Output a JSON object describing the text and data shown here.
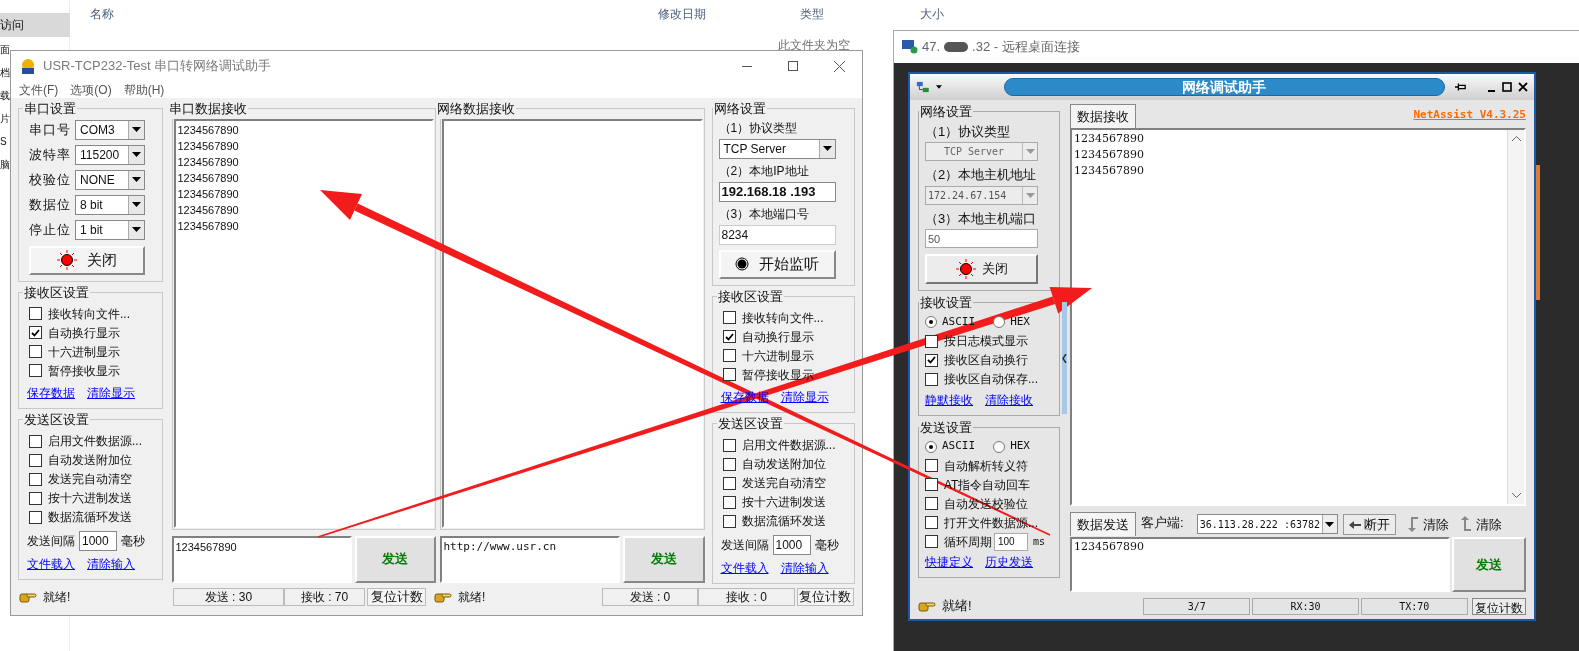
{
  "explorer": {
    "sidebar_items": [
      {
        "label": "访问",
        "selected": true
      },
      {
        "label": "面",
        "selected": false
      },
      {
        "label": "档",
        "selected": false
      },
      {
        "label": "载",
        "selected": false
      },
      {
        "label": "片",
        "selected": false
      },
      {
        "label": "S",
        "selected": false
      },
      {
        "label": "脑",
        "selected": false
      }
    ],
    "columns": [
      "名称",
      "修改日期",
      "类型",
      "大小"
    ],
    "empty_message": "此文件夹为空"
  },
  "usr_window": {
    "title": "USR-TCP232-Test 串口转网络调试助手",
    "menu": [
      "文件(F)",
      "选项(O)",
      "帮助(H)"
    ],
    "serial_settings": {
      "title": "串口设置",
      "fields": [
        {
          "label": "串口号",
          "value": "COM3"
        },
        {
          "label": "波特率",
          "value": "115200"
        },
        {
          "label": "校验位",
          "value": "NONE"
        },
        {
          "label": "数据位",
          "value": "8 bit"
        },
        {
          "label": "停止位",
          "value": "1 bit"
        }
      ],
      "button": "关闭"
    },
    "receive_settings": {
      "title": "接收区设置",
      "options": [
        {
          "label": "接收转向文件...",
          "checked": false
        },
        {
          "label": "自动换行显示",
          "checked": true
        },
        {
          "label": "十六进制显示",
          "checked": false
        },
        {
          "label": "暂停接收显示",
          "checked": false
        }
      ],
      "links": [
        "保存数据",
        "清除显示"
      ]
    },
    "send_settings": {
      "title": "发送区设置",
      "options": [
        {
          "label": "启用文件数据源...",
          "checked": false
        },
        {
          "label": "自动发送附加位",
          "checked": false
        },
        {
          "label": "发送完自动清空",
          "checked": false
        },
        {
          "label": "按十六进制发送",
          "checked": false
        },
        {
          "label": "数据流循环发送",
          "checked": false
        }
      ],
      "interval_label": "发送间隔",
      "interval": "1000",
      "interval_unit": "毫秒",
      "links": [
        "文件载入",
        "清除输入"
      ]
    },
    "serial_receive": {
      "title": "串口数据接收",
      "lines": [
        "1234567890",
        "1234567890",
        "1234567890",
        "1234567890",
        "1234567890",
        "1234567890",
        "1234567890"
      ]
    },
    "serial_send": {
      "value": "1234567890",
      "button": "发送"
    },
    "network_receive": {
      "title": "网络数据接收"
    },
    "network_send": {
      "value": "http://www.usr.cn",
      "button": "发送"
    },
    "network_settings": {
      "title": "网络设置",
      "protocol_label": "（1）协议类型",
      "protocol": "TCP Server",
      "ip_label": "（2）本地IP地址",
      "ip": "192.168.18 .193",
      "port_label": "（3）本地端口号",
      "port": "8234",
      "button": "开始监听"
    },
    "net_receive_settings": {
      "title": "接收区设置",
      "options": [
        {
          "label": "接收转向文件...",
          "checked": false
        },
        {
          "label": "自动换行显示",
          "checked": true
        },
        {
          "label": "十六进制显示",
          "checked": false
        },
        {
          "label": "暂停接收显示",
          "checked": false
        }
      ],
      "links": [
        "保存数据",
        "清除显示"
      ]
    },
    "net_send_settings": {
      "title": "发送区设置",
      "options": [
        {
          "label": "启用文件数据源...",
          "checked": false
        },
        {
          "label": "自动发送附加位",
          "checked": false
        },
        {
          "label": "发送完自动清空",
          "checked": false
        },
        {
          "label": "按十六进制发送",
          "checked": false
        },
        {
          "label": "数据流循环发送",
          "checked": false
        }
      ],
      "interval_label": "发送间隔",
      "interval": "1000",
      "interval_unit": "毫秒",
      "links": [
        "文件载入",
        "清除输入"
      ]
    },
    "status_serial": {
      "ready": "就绪!",
      "sent": "发送 : 30",
      "received": "接收 : 70",
      "reset": "复位计数"
    },
    "status_network": {
      "ready": "就绪!",
      "sent": "发送 : 0",
      "received": "接收 : 0",
      "reset": "复位计数"
    }
  },
  "rdp": {
    "title_start": "47.",
    "title_end": ".32 - 远程桌面连接"
  },
  "netassist": {
    "title": "网络调试助手",
    "settings": {
      "title": "网络设置",
      "protocol_label": "（1）协议类型",
      "protocol": "TCP Server",
      "host_label": "（2）本地主机地址",
      "host": "172.24.67.154",
      "port_label": "（3）本地主机端口",
      "port": "50",
      "button": "关闭"
    },
    "receive_settings": {
      "title": "接收设置",
      "formats": [
        {
          "label": "ASCII",
          "selected": true
        },
        {
          "label": "HEX",
          "selected": false
        }
      ],
      "options": [
        {
          "label": "按日志模式显示",
          "checked": false
        },
        {
          "label": "接收区自动换行",
          "checked": true
        },
        {
          "label": "接收区自动保存...",
          "checked": false
        }
      ],
      "links": [
        "静默接收",
        "清除接收"
      ]
    },
    "send_settings": {
      "title": "发送设置",
      "formats": [
        {
          "label": "ASCII",
          "selected": true
        },
        {
          "label": "HEX",
          "selected": false
        }
      ],
      "options": [
        {
          "label": "自动解析转义符",
          "checked": false
        },
        {
          "label": "AT指令自动回车",
          "checked": false
        },
        {
          "label": "自动发送校验位",
          "checked": false
        },
        {
          "label": "打开文件数据源...",
          "checked": false
        }
      ],
      "cycle": {
        "label": "循环周期",
        "checked": false,
        "value": "100",
        "unit": "ms"
      },
      "links": [
        "快捷定义",
        "历史发送"
      ]
    },
    "receive_tab": {
      "label": "数据接收",
      "selected": true
    },
    "version": "NetAssist V4.3.25",
    "received_lines": [
      "1234567890",
      "1234567890",
      "1234567890"
    ],
    "send_tab": {
      "label": "数据发送",
      "selected": true
    },
    "client_label": "客户端:",
    "client": "36.113.28.222 :63782",
    "disconnect": "断开",
    "clear_buttons": [
      "清除",
      "清除"
    ],
    "send_value": "1234567890",
    "send_button": "发送",
    "status": {
      "ready": "就绪!",
      "counts": [
        "3/7",
        "RX:30",
        "TX:70"
      ],
      "reset": "复位计数"
    }
  }
}
